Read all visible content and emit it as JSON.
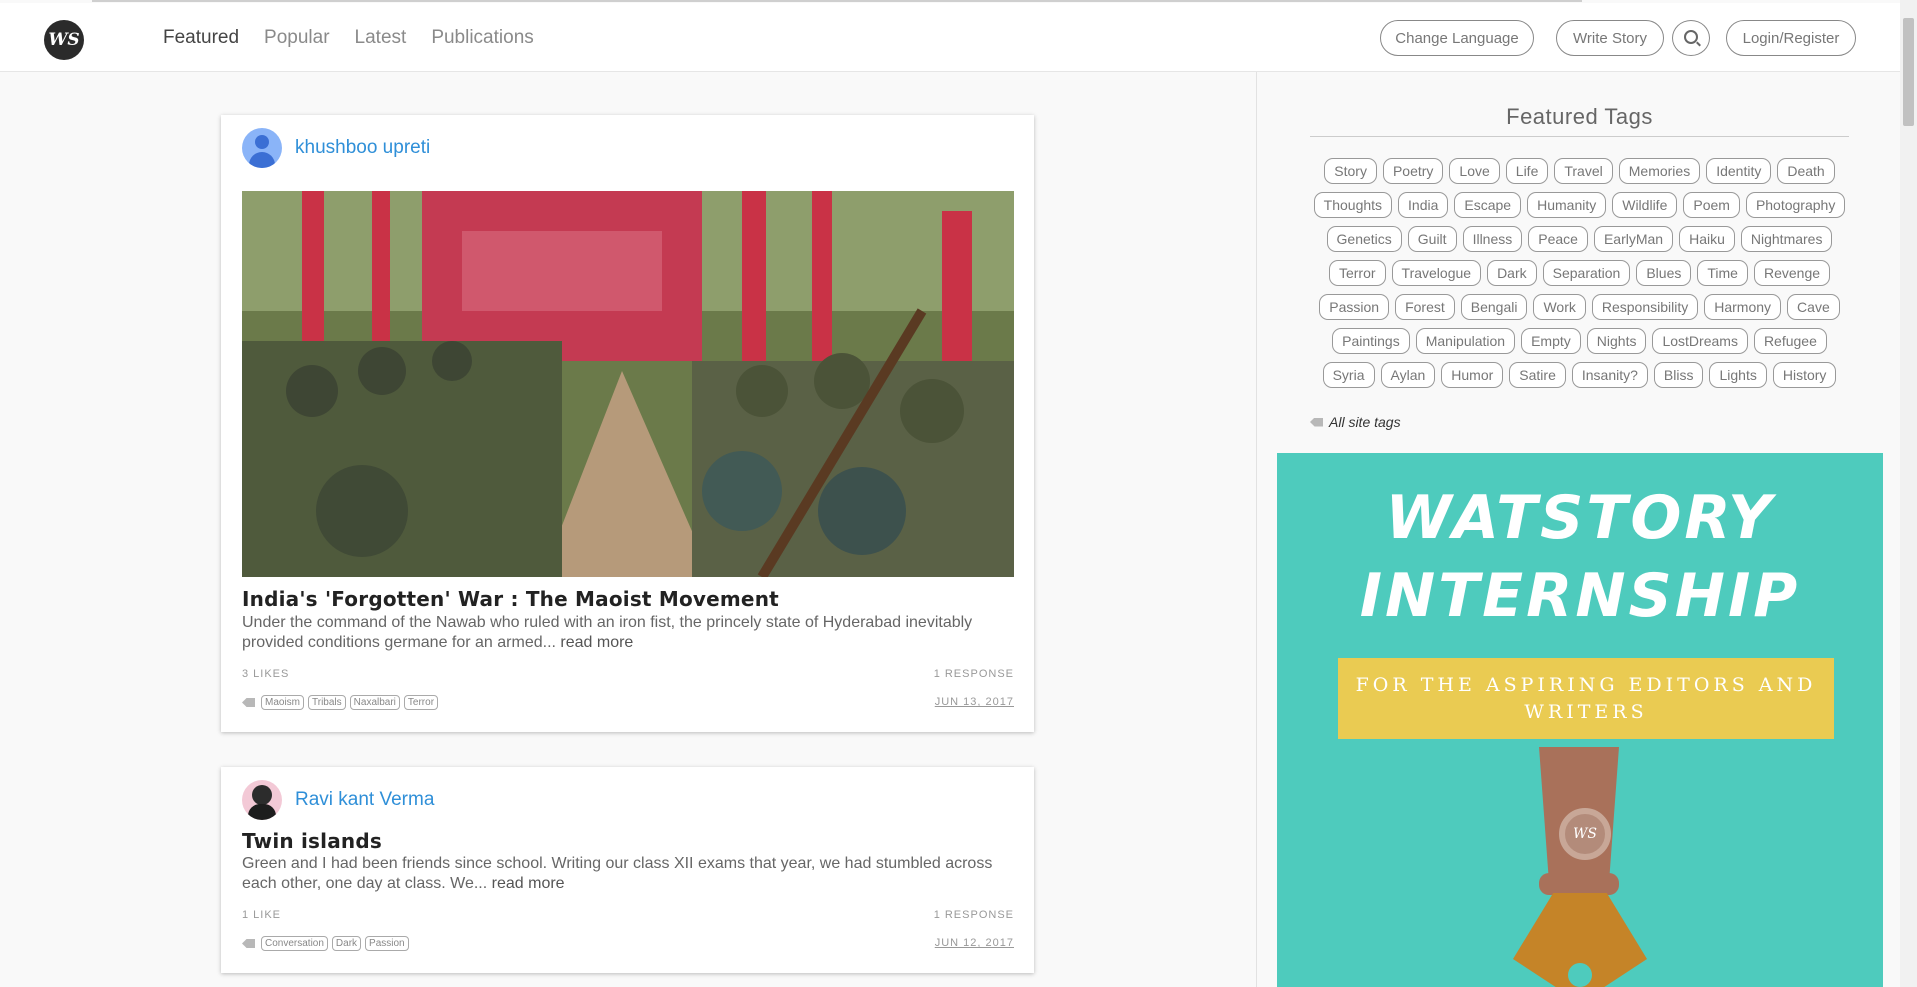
{
  "brand": {
    "logo_text": "WS"
  },
  "nav": {
    "items": [
      "Featured",
      "Popular",
      "Latest",
      "Publications"
    ],
    "active": "Featured"
  },
  "header_buttons": {
    "change_language": "Change Language",
    "write_story": "Write Story",
    "login_register": "Login/Register"
  },
  "posts": [
    {
      "author": "khushboo upreti",
      "title": "India's 'Forgotten' War : The Maoist Movement",
      "excerpt": "Under the command of the Nawab who ruled with an iron fist, the princely state of Hyderabad inevitably provided conditions germane for an armed...",
      "read_more": "read more",
      "likes": "3 LIKES",
      "responses": "1 RESPONSE",
      "tags": [
        "Maoism",
        "Tribals",
        "Naxalbari",
        "Terror"
      ],
      "date": "JUN 13, 2017"
    },
    {
      "author": "Ravi kant Verma",
      "title": "Twin islands",
      "excerpt": "Green and I had been friends since school. Writing our class XII exams that year, we had stumbled across each other, one day at class. We...",
      "read_more": "read more",
      "likes": "1 LIKE",
      "responses": "1 RESPONSE",
      "tags": [
        "Conversation",
        "Dark",
        "Passion"
      ],
      "date": "JUN 12, 2017"
    }
  ],
  "sidebar": {
    "featured_tags_title": "Featured Tags",
    "tags": [
      "Story",
      "Poetry",
      "Love",
      "Life",
      "Travel",
      "Memories",
      "Identity",
      "Death",
      "Thoughts",
      "India",
      "Escape",
      "Humanity",
      "Wildlife",
      "Poem",
      "Photography",
      "Genetics",
      "Guilt",
      "Illness",
      "Peace",
      "EarlyMan",
      "Haiku",
      "Nightmares",
      "Terror",
      "Travelogue",
      "Dark",
      "Separation",
      "Blues",
      "Time",
      "Revenge",
      "Passion",
      "Forest",
      "Bengali",
      "Work",
      "Responsibility",
      "Harmony",
      "Cave",
      "Paintings",
      "Manipulation",
      "Empty",
      "Nights",
      "LostDreams",
      "Refugee",
      "Syria",
      "Aylan",
      "Humor",
      "Satire",
      "Insanity?",
      "Bliss",
      "Lights",
      "History"
    ],
    "all_site_tags": "All site tags"
  },
  "ad": {
    "line1": "WATSTORY",
    "line2": "INTERNSHIP",
    "subtitle": "FOR THE ASPIRING EDITORS AND WRITERS",
    "badge": "WS",
    "background_color": "#4ecbbd",
    "box_color": "#eacb52"
  }
}
